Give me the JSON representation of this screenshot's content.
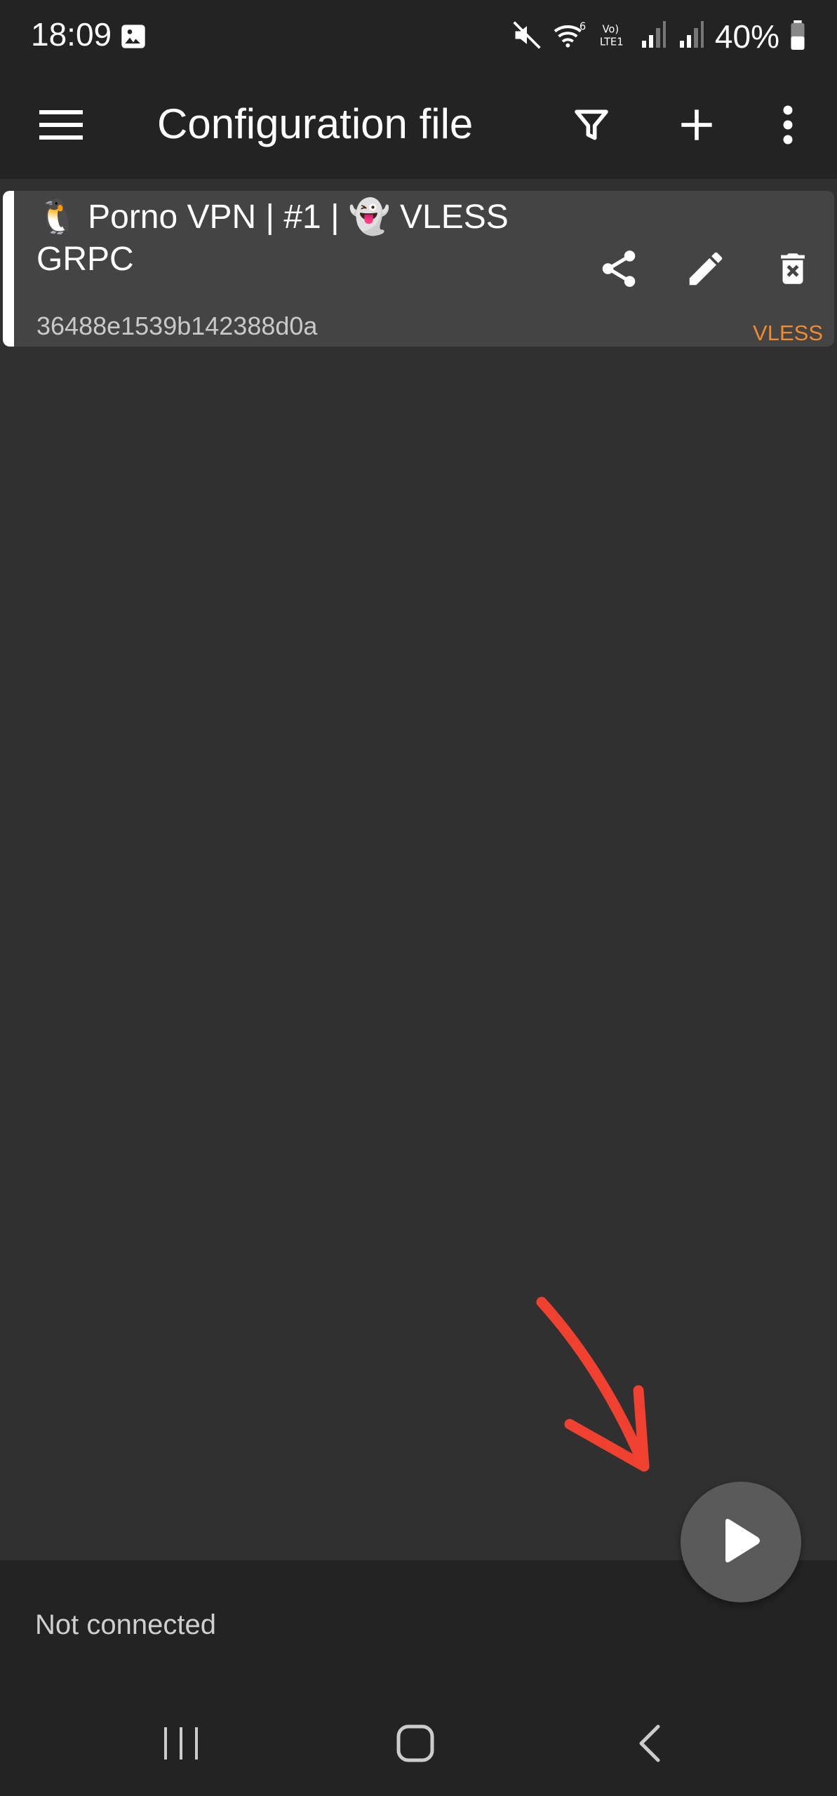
{
  "status_bar": {
    "time": "18:09",
    "battery": "40%",
    "icons": [
      "gallery-icon",
      "mute-icon",
      "wifi-6-icon",
      "volte-icon",
      "signal-icon",
      "signal-icon",
      "battery-icon"
    ]
  },
  "toolbar": {
    "title": "Configuration file",
    "icons": [
      "menu-icon",
      "filter-icon",
      "plus-icon",
      "more-vert-icon"
    ]
  },
  "server_list": [
    {
      "title": "🐧 Porno VPN | #1 | 👻 VLESS GRPC",
      "subtitle": "36488e1539b142388d0a",
      "type": "VLESS",
      "actions": [
        "share-icon",
        "edit-icon",
        "delete-icon"
      ]
    }
  ],
  "connection": {
    "status": "Not connected",
    "fab_icon": "play-icon"
  },
  "colors": {
    "background": "#303030",
    "bars": "#232323",
    "card": "#444444",
    "type_accent": "#f28a2e",
    "annotation_arrow": "#f04030"
  },
  "annotation": "red-arrow pointing at play button"
}
